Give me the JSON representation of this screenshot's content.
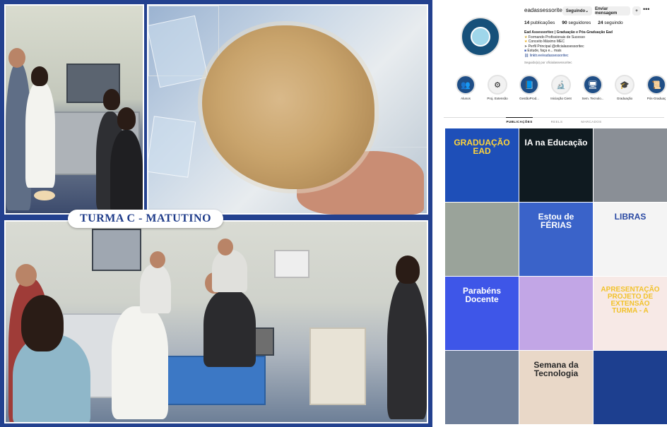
{
  "collage": {
    "banner": "TURMA C - MATUTINO"
  },
  "profile": {
    "username": "eadassessoritec",
    "buttons": {
      "follow": "Seguindo",
      "message": "Enviar mensagem"
    },
    "stats": {
      "posts_count": "14",
      "posts_label": "publicações",
      "followers_count": "90",
      "followers_label": "seguidores",
      "following_count": "24",
      "following_label": "seguindo"
    },
    "bio": {
      "name": "Ead Assessoritec | Graduação e Pós-Graduação Ead",
      "line1": "Formando Profissionais de Sucesso",
      "line2": "Conceito Máximo MEC",
      "line3": "Perfil Principal @oficialassessoritec",
      "line4": "Estude, faça e... mais",
      "link": "linktr.ee/eadassessoritec"
    },
    "followed_by": "Seguido(a) por oficialassessoritec"
  },
  "highlights": [
    {
      "label": "Alunos",
      "icon": "users-icon",
      "glyph": "👥"
    },
    {
      "label": "Proj. Extensão",
      "icon": "gear-icon",
      "glyph": "⚙"
    },
    {
      "label": "GestãoProd...",
      "icon": "book-icon",
      "glyph": "📘"
    },
    {
      "label": "Iniciação Cient",
      "icon": "microscope-icon",
      "glyph": "🔬"
    },
    {
      "label": "Sem. Tecnolo...",
      "icon": "monitor-icon",
      "glyph": "🖥"
    },
    {
      "label": "Graduação",
      "icon": "graduation-cap-icon",
      "glyph": "🎓"
    },
    {
      "label": "Pós-Graduaç",
      "icon": "certificate-icon",
      "glyph": "📜"
    }
  ],
  "tabs": [
    "PUBLICAÇÕES",
    "REELS",
    "MARCADOS"
  ],
  "posts": [
    {
      "text": "GRADUAÇÃO EAD",
      "bg": "#1e4fb8",
      "fg": "#ffd43b"
    },
    {
      "text": "IA na Educação",
      "bg": "#0f1a20",
      "fg": "#ffffff"
    },
    {
      "text": "",
      "bg": "#8a8f96",
      "fg": "#ffffff"
    },
    {
      "text": "",
      "bg": "#9aa39a",
      "fg": "#ffffff"
    },
    {
      "text": "Estou de FÉRIAS",
      "bg": "#3a63c9",
      "fg": "#ffffff"
    },
    {
      "text": "LIBRAS",
      "bg": "#f4f4f4",
      "fg": "#2b4aa3"
    },
    {
      "text": "Parabéns Docente",
      "bg": "#3e56e8",
      "fg": "#ffffff"
    },
    {
      "text": "",
      "bg": "#c2a6e6",
      "fg": "#ffffff"
    },
    {
      "text": "APRESENTAÇÃO PROJETO DE EXTENSÃO TURMA - A",
      "bg": "#f7e9e6",
      "fg": "#f2c22b"
    },
    {
      "text": "",
      "bg": "#6f7f99",
      "fg": "#ffffff"
    },
    {
      "text": "Semana da Tecnologia",
      "bg": "#e9d8c8",
      "fg": "#2a2a2a"
    },
    {
      "text": "",
      "bg": "#1d3f8f",
      "fg": "#ffd43b"
    }
  ]
}
